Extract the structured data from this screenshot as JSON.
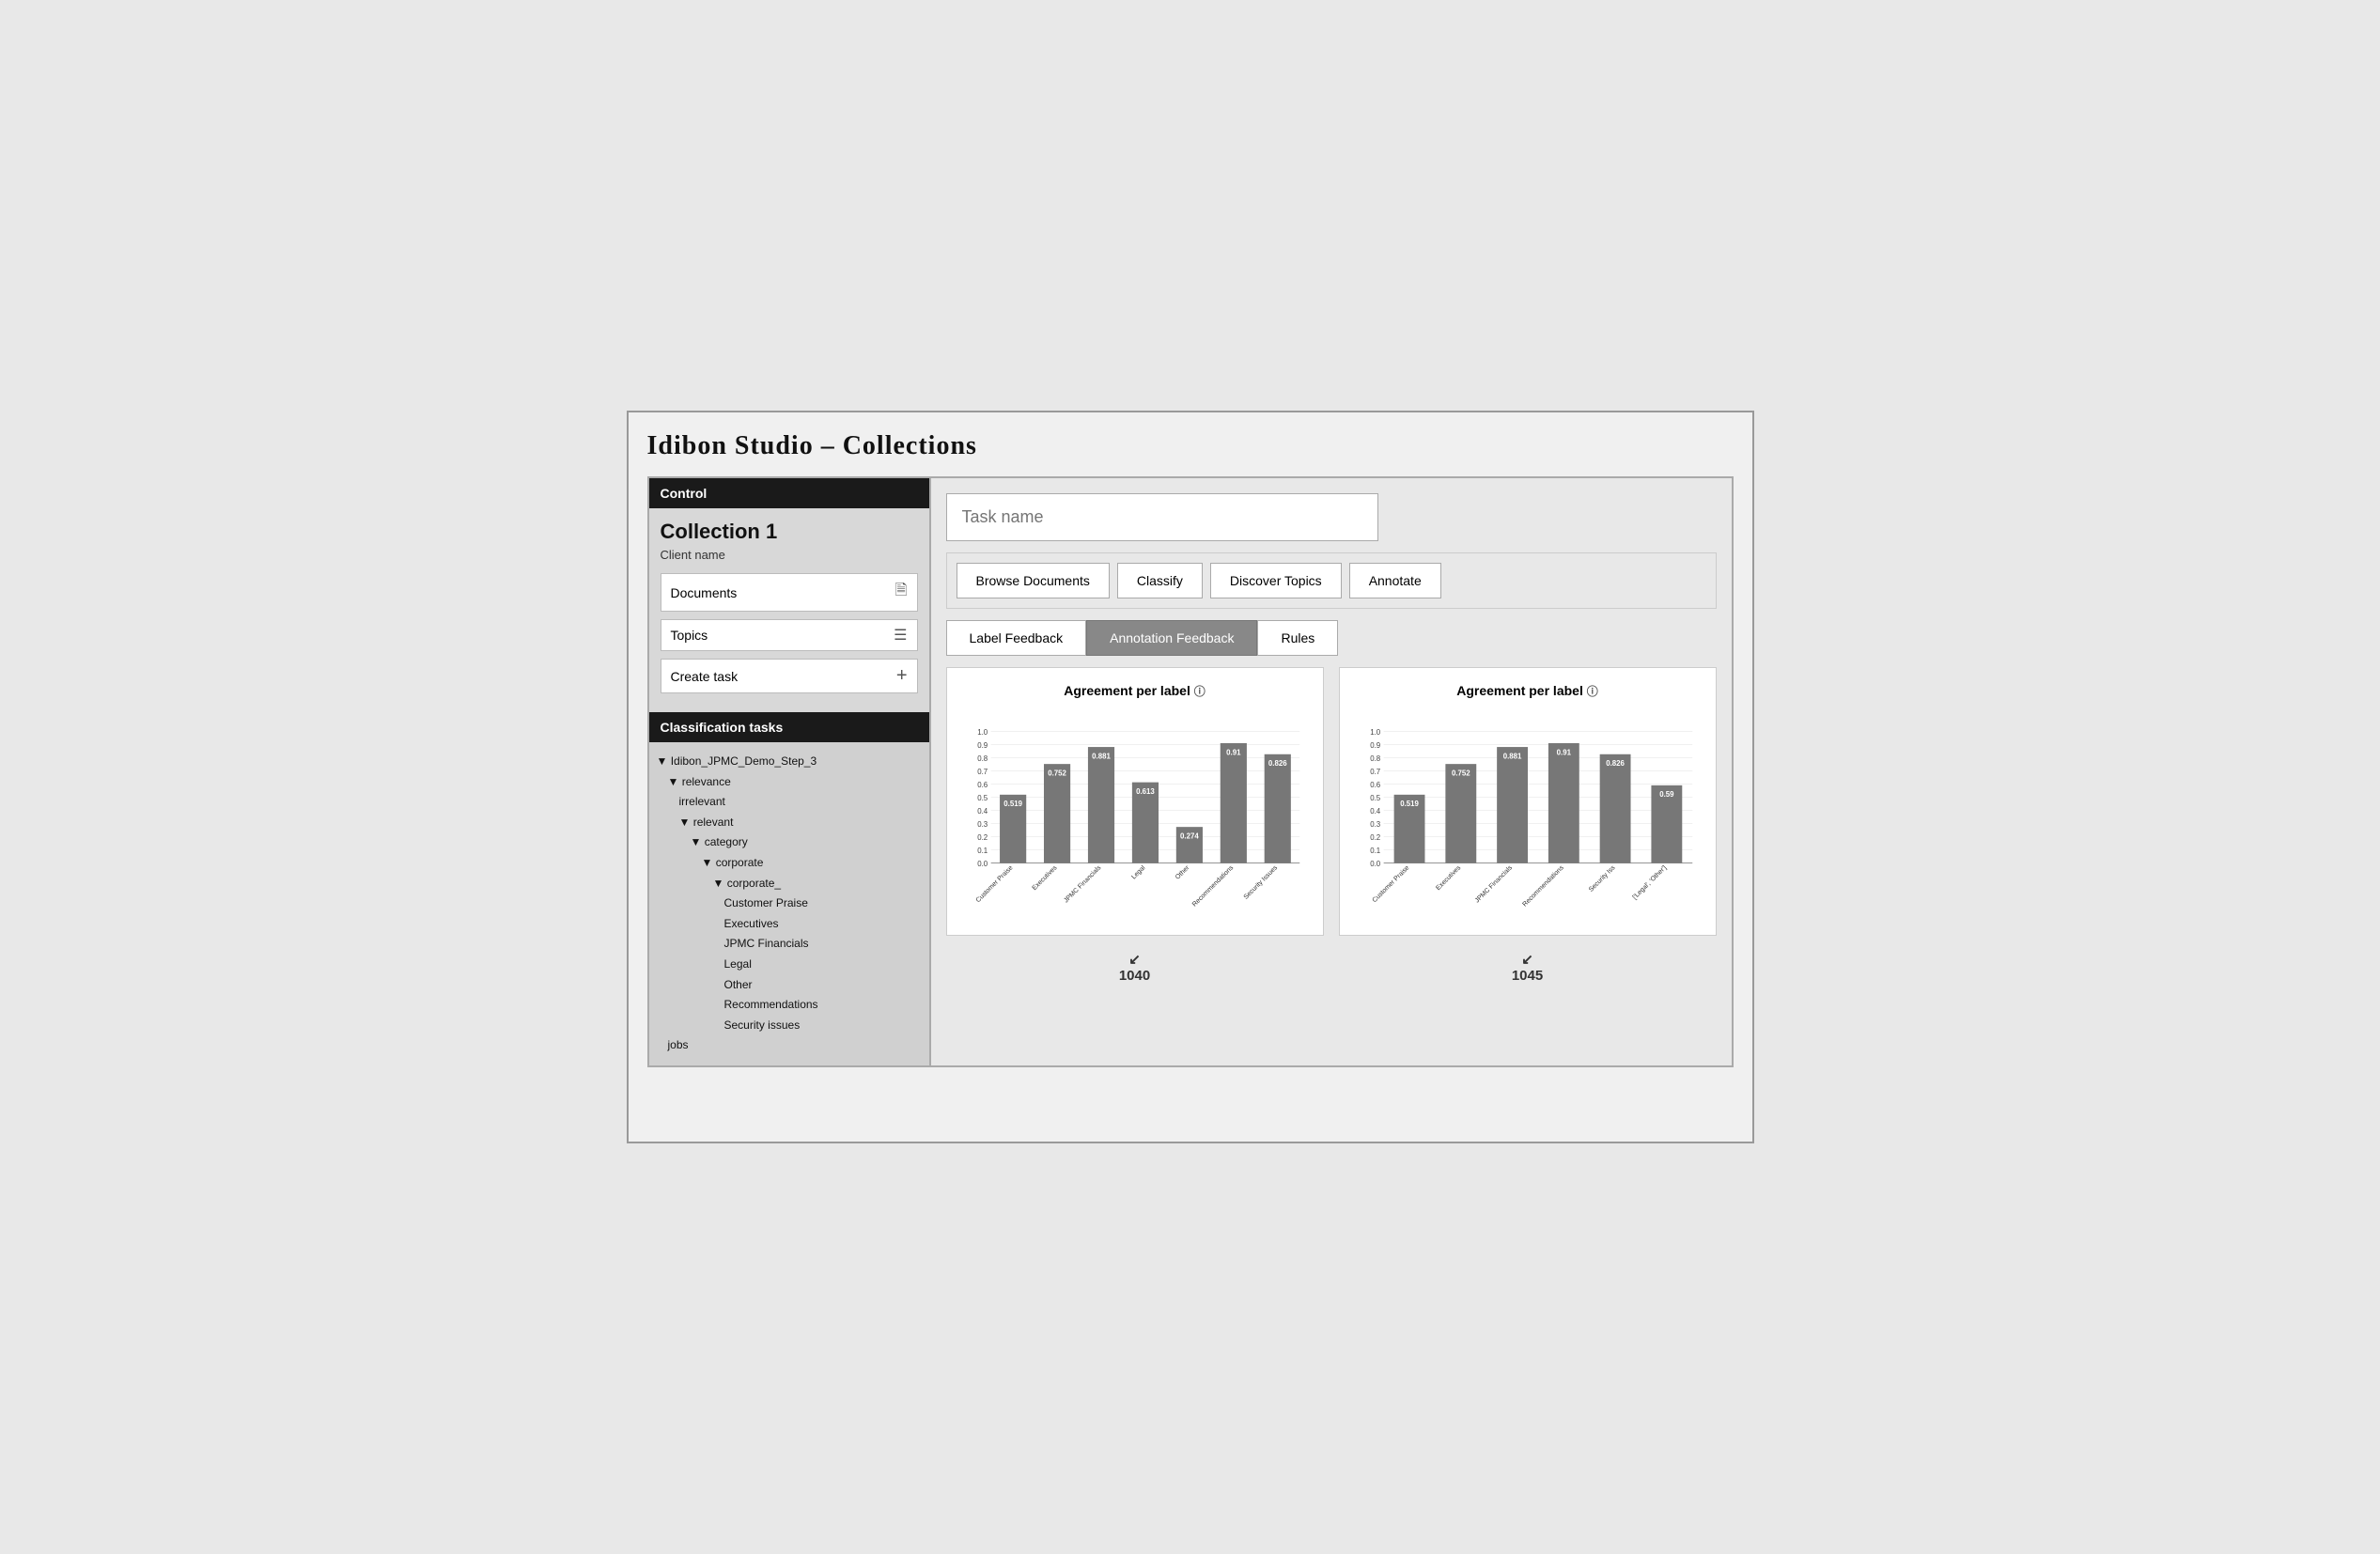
{
  "app": {
    "title": "Idibon Studio – Collections"
  },
  "sidebar": {
    "control_header": "Control",
    "collection_title": "Collection 1",
    "client_name": "Client name",
    "documents_btn": "Documents",
    "topics_btn": "Topics",
    "create_task_btn": "Create task",
    "classification_tasks_header": "Classification tasks",
    "tree": [
      {
        "label": "▼ Idibon_JPMC_Demo_Step_3",
        "level": 0
      },
      {
        "label": "▼ relevance",
        "level": 1
      },
      {
        "label": "irrelevant",
        "level": 2
      },
      {
        "label": "▼ relevant",
        "level": 2
      },
      {
        "label": "▼ category",
        "level": 3
      },
      {
        "label": "▼ corporate",
        "level": 4
      },
      {
        "label": "▼ corporate_",
        "level": 5
      },
      {
        "label": "Customer Praise",
        "level": 6
      },
      {
        "label": "Executives",
        "level": 6
      },
      {
        "label": "JPMC Financials",
        "level": 6
      },
      {
        "label": "Legal",
        "level": 6
      },
      {
        "label": "Other",
        "level": 6
      },
      {
        "label": "Recommendations",
        "level": 6
      },
      {
        "label": "Security issues",
        "level": 6
      },
      {
        "label": "jobs",
        "level": 1
      }
    ]
  },
  "main": {
    "task_name_placeholder": "Task name",
    "tabs": [
      {
        "label": "Browse Documents"
      },
      {
        "label": "Classify"
      },
      {
        "label": "Discover Topics"
      },
      {
        "label": "Annotate"
      }
    ],
    "feedback_tabs": [
      {
        "label": "Label Feedback",
        "active": false
      },
      {
        "label": "Annotation Feedback",
        "active": true
      },
      {
        "label": "Rules",
        "active": false
      }
    ],
    "chart1": {
      "title": "Agreement per label",
      "info_icon": "ⓘ",
      "bars": [
        {
          "label": "Customer Praise",
          "value": 0.519,
          "short_label": "Customer Praise"
        },
        {
          "label": "Executives",
          "value": 0.752,
          "short_label": "Executives"
        },
        {
          "label": "JPMC Financials",
          "value": 0.881,
          "short_label": "JPMC Financials"
        },
        {
          "label": "Legal",
          "value": 0.613,
          "short_label": "Legal"
        },
        {
          "label": "Other",
          "value": 0.274,
          "short_label": "Other"
        },
        {
          "label": "Recommendations",
          "value": 0.91,
          "short_label": "Recommendations"
        },
        {
          "label": "Security Issues",
          "value": 0.826,
          "short_label": "Security Issues"
        }
      ],
      "label": "1040",
      "y_max": 1.0,
      "y_ticks": [
        "1.0",
        "0.9",
        "0.8",
        "0.7",
        "0.6",
        "0.5",
        "0.4",
        "0.3",
        "0.2",
        "0.1",
        "0.0"
      ]
    },
    "chart2": {
      "title": "Agreement per label",
      "info_icon": "ⓘ",
      "bars": [
        {
          "label": "Customer Praise",
          "value": 0.519,
          "short_label": "Customer Praise"
        },
        {
          "label": "Executives",
          "value": 0.752,
          "short_label": "Executives"
        },
        {
          "label": "JPMC Financials",
          "value": 0.881,
          "short_label": "JPMC Financials"
        },
        {
          "label": "Recommendations",
          "value": 0.91,
          "short_label": "Recommendations"
        },
        {
          "label": "Security Issues",
          "value": 0.826,
          "short_label": "Security Iss"
        },
        {
          "label": "['Legal', 'Other']",
          "value": 0.59,
          "short_label": "['Legal', 'Other']"
        }
      ],
      "label": "1045",
      "y_max": 1.0,
      "y_ticks": [
        "1.0",
        "0.9",
        "0.8",
        "0.7",
        "0.6",
        "0.5",
        "0.4",
        "0.3",
        "0.2",
        "0.1",
        "0.0"
      ]
    }
  },
  "colors": {
    "bar_fill": "#777",
    "bar_active": "#555",
    "header_bg": "#1a1a1a"
  }
}
